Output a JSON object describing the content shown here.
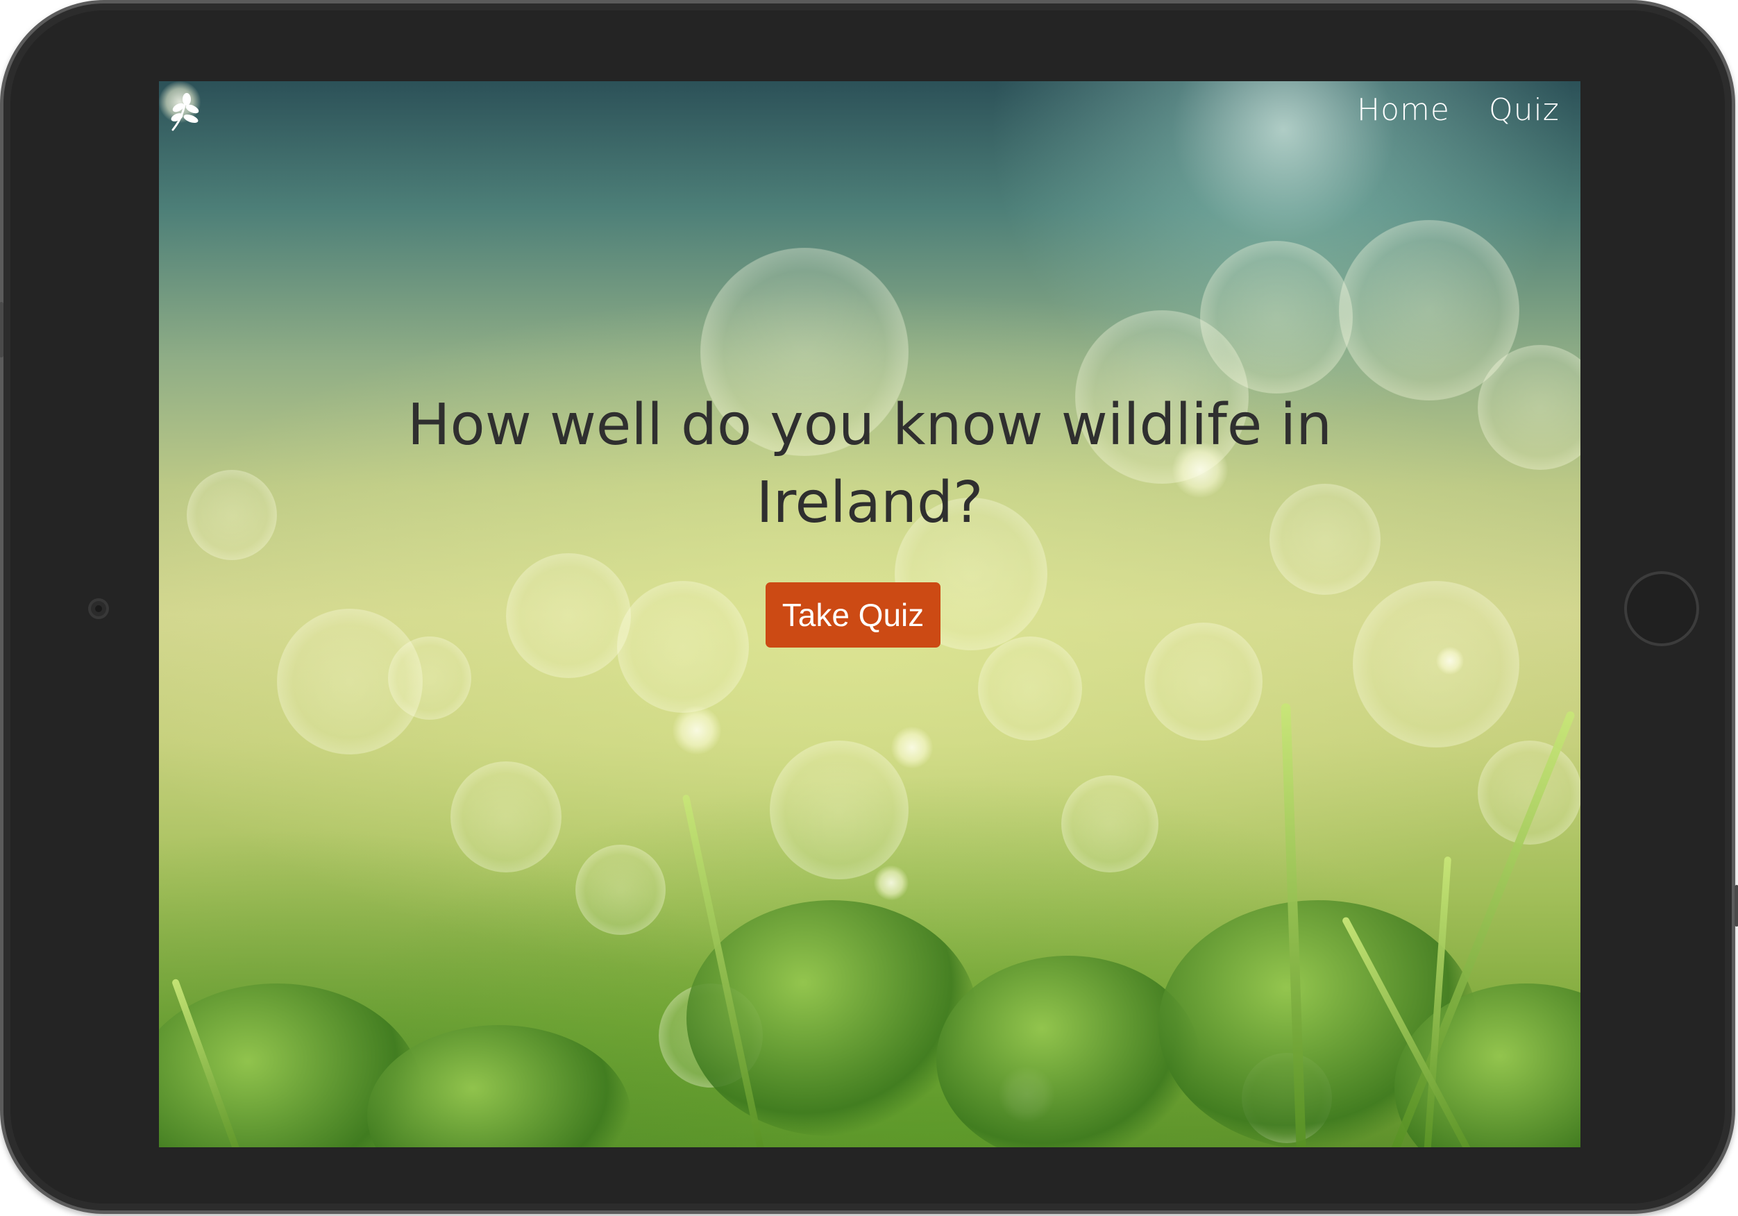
{
  "navbar": {
    "brand_icon": "leaf-sprig-icon",
    "links": [
      {
        "label": "Home"
      },
      {
        "label": "Quiz"
      }
    ]
  },
  "hero": {
    "title": "How well do you know wildlife in Ireland?",
    "cta_label": "Take Quiz"
  },
  "colors": {
    "cta_background": "#cc4a14",
    "title_text": "#2f2f2f",
    "nav_text": "#ffffff",
    "device_frame": "#242424"
  }
}
